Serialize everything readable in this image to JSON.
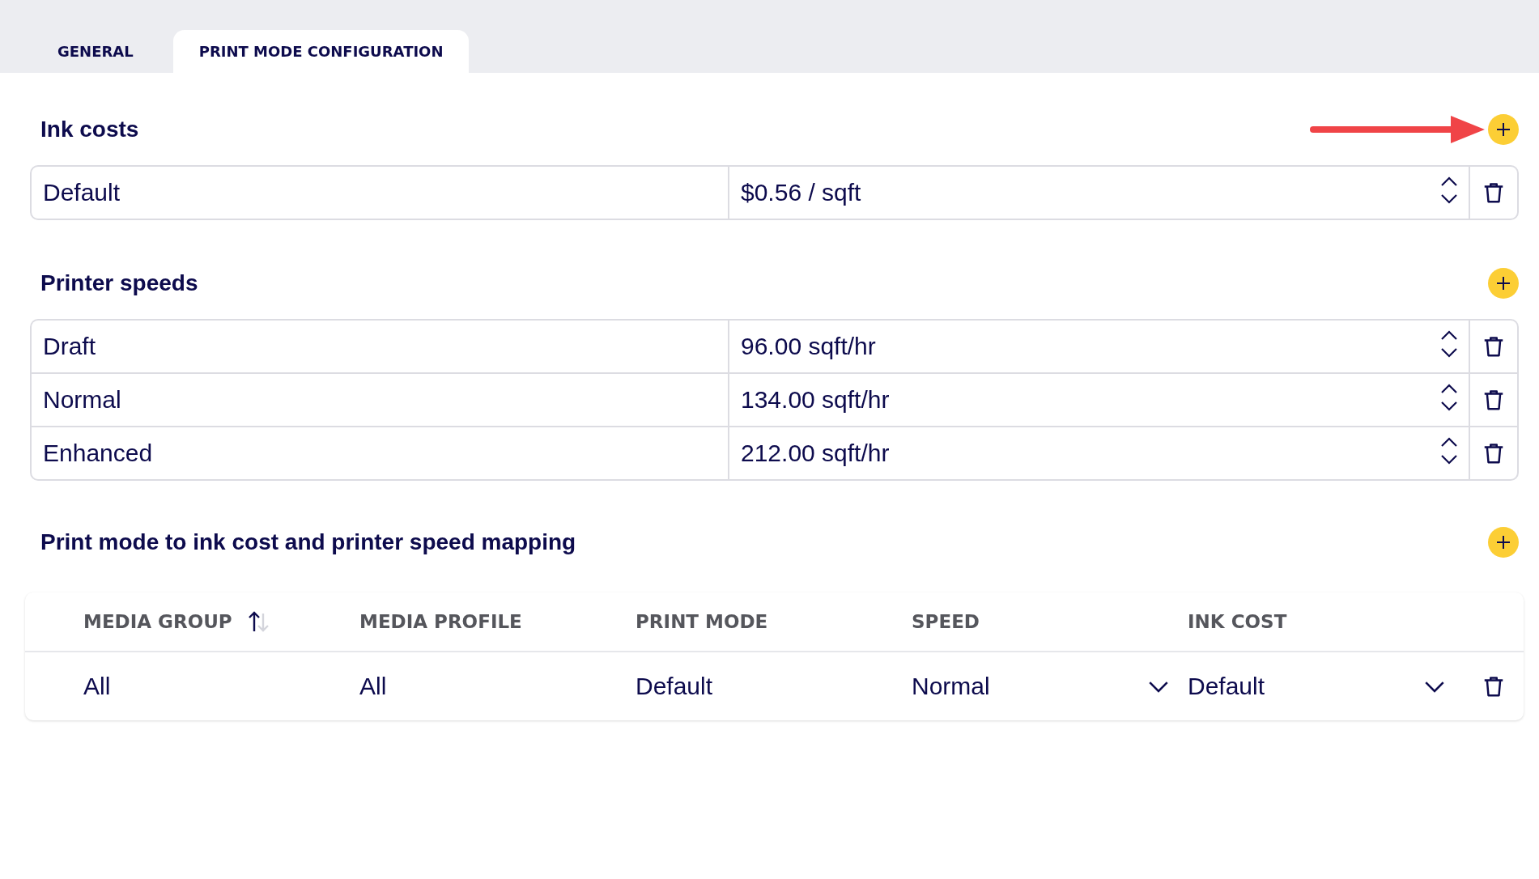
{
  "tabs": [
    {
      "label": "GENERAL",
      "selected": false
    },
    {
      "label": "PRINT MODE CONFIGURATION",
      "selected": true
    }
  ],
  "ink_costs": {
    "title": "Ink costs",
    "rows": [
      {
        "name": "Default",
        "value": "$0.56 / sqft"
      }
    ]
  },
  "printer_speeds": {
    "title": "Printer speeds",
    "rows": [
      {
        "name": "Draft",
        "value": "96.00 sqft/hr"
      },
      {
        "name": "Normal",
        "value": "134.00 sqft/hr"
      },
      {
        "name": "Enhanced",
        "value": "212.00 sqft/hr"
      }
    ]
  },
  "mapping": {
    "title": "Print mode to ink cost and printer speed mapping",
    "columns": [
      {
        "label": "MEDIA GROUP",
        "sorted": true
      },
      {
        "label": "MEDIA PROFILE",
        "sorted": false
      },
      {
        "label": "PRINT MODE",
        "sorted": false
      },
      {
        "label": "SPEED",
        "sorted": false
      },
      {
        "label": "INK COST",
        "sorted": false
      }
    ],
    "rows": [
      {
        "cells": [
          {
            "kind": "text",
            "value": "All"
          },
          {
            "kind": "text",
            "value": "All"
          },
          {
            "kind": "text",
            "value": "Default"
          },
          {
            "kind": "dropdown",
            "value": "Normal"
          },
          {
            "kind": "dropdown",
            "value": "Default"
          }
        ]
      }
    ]
  }
}
